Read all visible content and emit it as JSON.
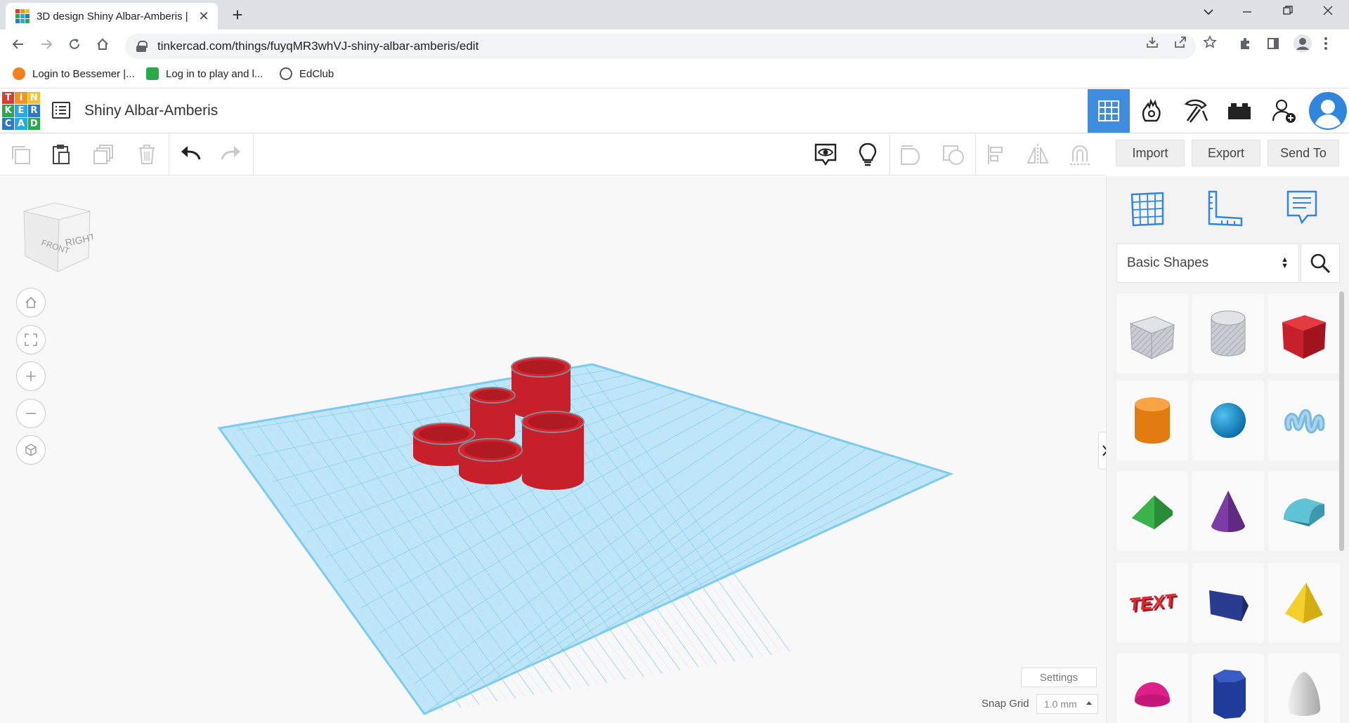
{
  "browser": {
    "tab_title": "3D design Shiny Albar-Amberis |",
    "tab_close": "✕",
    "new_tab": "+",
    "url": "tinkercad.com/things/fuyqMR3whVJ-shiny-albar-amberis/edit",
    "bookmarks": [
      {
        "label": "Login to Bessemer |...",
        "icon_color": "#f4811f"
      },
      {
        "label": "Log in to play and l...",
        "icon_color": "#2aa94b"
      },
      {
        "label": "EdClub",
        "icon_color": "#555555"
      }
    ]
  },
  "app": {
    "logo_letters": [
      "T",
      "I",
      "N",
      "K",
      "E",
      "R",
      "C",
      "A",
      "D"
    ],
    "logo_colors": [
      "#e2382d",
      "#f6921e",
      "#f3c32b",
      "#2aa94b",
      "#27aae1",
      "#2b78c5",
      "#2b78c5",
      "#27aae1",
      "#2aa94b"
    ],
    "design_title": "Shiny Albar-Amberis",
    "accent_color": "#3e8de0"
  },
  "toolbar": {
    "import_label": "Import",
    "export_label": "Export",
    "sendto_label": "Send To"
  },
  "viewcube": {
    "front_label": "FRONT",
    "right_label": "RIGHT"
  },
  "workplane": {
    "settings_label": "Settings",
    "snap_label": "Snap Grid",
    "snap_value": "1.0 mm",
    "grid_color": "#7ccbef",
    "shape_color": "#d9202b"
  },
  "panel": {
    "category": "Basic Shapes",
    "shapes": [
      {
        "name": "box-hole",
        "color": "#b8bcc4"
      },
      {
        "name": "cylinder-hole",
        "color": "#b8bcc4"
      },
      {
        "name": "box",
        "color": "#d9202b"
      },
      {
        "name": "cylinder",
        "color": "#f08a1c"
      },
      {
        "name": "sphere",
        "color": "#1a8fd1"
      },
      {
        "name": "scribble",
        "color": "#7ab8dd"
      },
      {
        "name": "roof",
        "color": "#2e9a3b"
      },
      {
        "name": "cone",
        "color": "#7d3ca5"
      },
      {
        "name": "round-roof",
        "color": "#4fb5c9"
      },
      {
        "name": "text",
        "color": "#c8202a"
      },
      {
        "name": "wedge",
        "color": "#2a3c8f"
      },
      {
        "name": "pyramid",
        "color": "#f0c81c"
      },
      {
        "name": "half-sphere",
        "color": "#e0208a"
      },
      {
        "name": "polygon",
        "color": "#1f3c9a"
      },
      {
        "name": "paraboloid",
        "color": "#cfcfcf"
      }
    ],
    "text_shape_label": "TEXT"
  }
}
